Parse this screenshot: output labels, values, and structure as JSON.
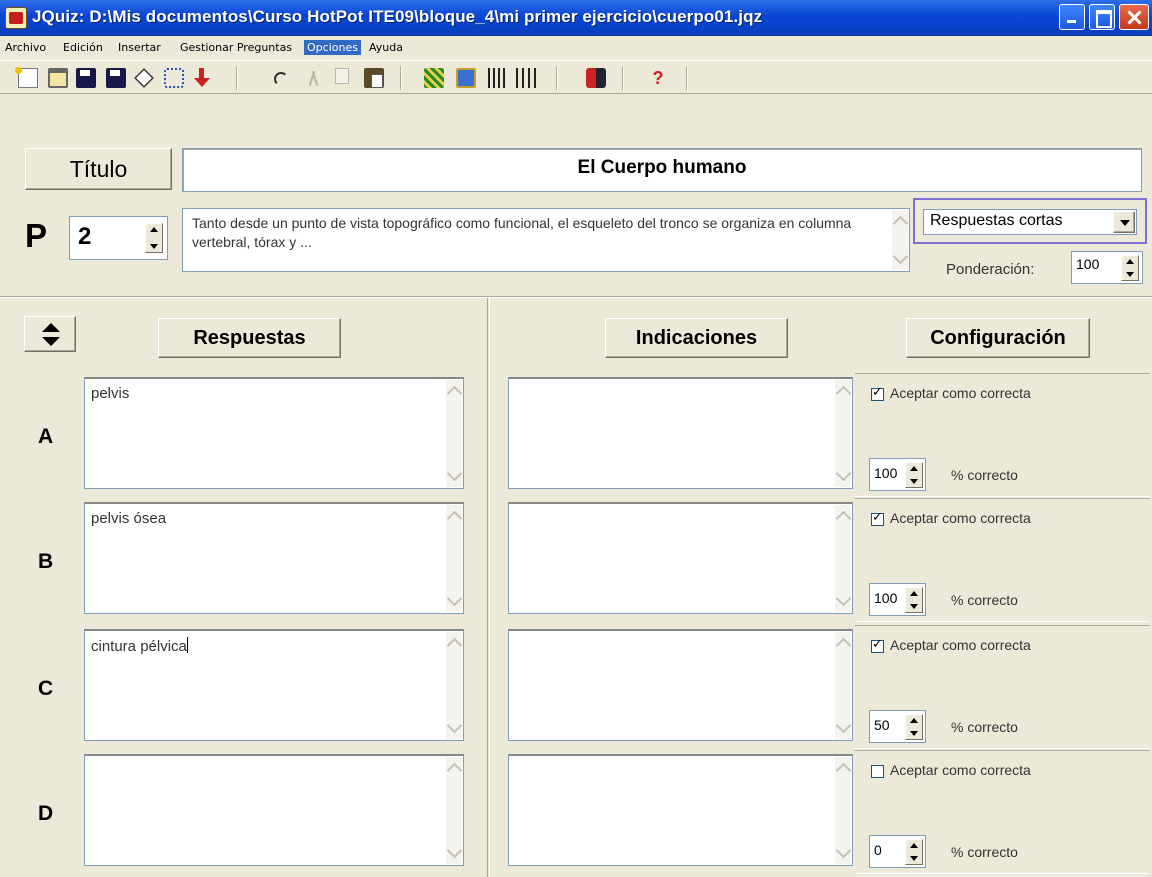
{
  "window": {
    "title": "JQuiz: D:\\Mis documentos\\Curso HotPot ITE09\\bloque_4\\mi primer ejercicio\\cuerpo01.jqz"
  },
  "menu": [
    "Archivo",
    "Edición",
    "Insertar",
    "Gestionar Preguntas",
    "Opciones",
    "Ayuda"
  ],
  "menu_active": "Opciones",
  "toolbar": {
    "icons": [
      "new-file-icon",
      "open-folder-icon",
      "save-icon",
      "save-as-icon",
      "eraser-icon",
      "web-page-icon",
      "export-arrow-icon",
      "undo-icon",
      "cut-icon",
      "copy-icon",
      "paste-icon",
      "green-tool-icon",
      "blue-tool-icon",
      "text-tool-icon",
      "text-tool-2-icon",
      "flag-icon",
      "help-icon"
    ],
    "help_glyph": "?"
  },
  "quiz": {
    "title_label": "Título",
    "title_value": "El Cuerpo humano",
    "question_label": "P",
    "question_number": "2",
    "question_text": "Tanto desde un punto de vista topográfico como funcional, el esqueleto del tronco se organiza en columna vertebral, tórax y ...",
    "question_type": "Respuestas cortas",
    "weighting_label": "Ponderación:",
    "weighting_value": "100"
  },
  "headers": {
    "answers": "Respuestas",
    "hints": "Indicaciones",
    "settings": "Configuración"
  },
  "answers": [
    {
      "letter": "A",
      "text": "pelvis",
      "hint": "",
      "accept_label": "Aceptar como correcta",
      "accepted": true,
      "percent": "100",
      "percent_label": "% correcto"
    },
    {
      "letter": "B",
      "text": "pelvis ósea",
      "hint": "",
      "accept_label": "Aceptar como correcta",
      "accepted": true,
      "percent": "100",
      "percent_label": "% correcto"
    },
    {
      "letter": "C",
      "text": "cintura pélvica",
      "hint": "",
      "accept_label": "Aceptar como correcta",
      "accepted": true,
      "percent": "50",
      "percent_label": "% correcto"
    },
    {
      "letter": "D",
      "text": "",
      "hint": "",
      "accept_label": "Aceptar como correcta",
      "accepted": false,
      "percent": "0",
      "percent_label": "% correcto"
    }
  ],
  "colors": {
    "titlebar": "#0a46d6",
    "menu_highlight": "#316ac5",
    "type_select_border": "#7d6fd6"
  }
}
